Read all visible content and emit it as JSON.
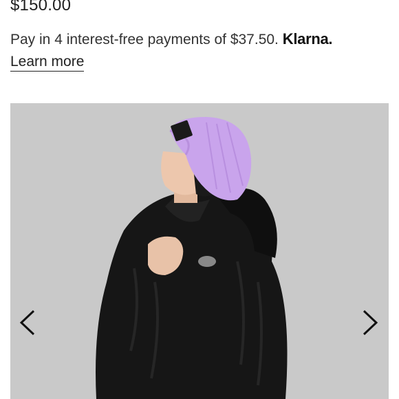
{
  "product": {
    "price": "$150.00"
  },
  "klarna": {
    "message": "Pay in 4 interest-free payments of $37.50.",
    "brand": "Klarna.",
    "learn_more": "Learn more"
  },
  "carousel": {
    "image_alt": "Child wearing a lilac beanie and black fleece jacket",
    "prev_icon": "chevron-left-icon",
    "next_icon": "chevron-right-icon",
    "colors": {
      "background": "#c9c9c9",
      "beanie": "#c9a4ec",
      "jacket": "#161616"
    }
  }
}
